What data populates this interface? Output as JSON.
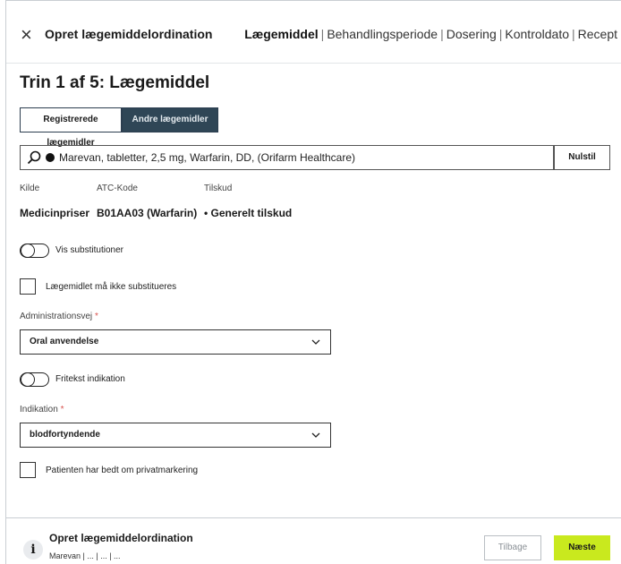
{
  "header": {
    "title": "Opret lægemiddelordination",
    "steps": [
      "Lægemiddel",
      "Behandlingsperiode",
      "Dosering",
      "Kontroldato",
      "Recept"
    ],
    "step_sep": "|"
  },
  "step_title": "Trin 1 af 5: Lægemiddel",
  "tabs": {
    "registered": "Registrerede lægemidler",
    "other": "Andre lægemidler"
  },
  "search": {
    "value": "Marevan, tabletter, 2,5 mg, Warfarin, DD, (Orifarm Healthcare)",
    "reset_label": "Nulstil"
  },
  "info": {
    "source_label": "Kilde",
    "source_value": "Medicinpriser",
    "atc_label": "ATC-Kode",
    "atc_value": "B01AA03 (Warfarin)",
    "subsidy_label": "Tilskud",
    "subsidy_value": "• Generelt tilskud"
  },
  "substitution_toggle": "Vis substitutioner",
  "no_substitute_checkbox": "Lægemidlet må ikke substitueres",
  "admin_route": {
    "label": "Administrationsvej",
    "required": "*",
    "value": "Oral anvendelse"
  },
  "free_text_toggle": "Fritekst indikation",
  "indication": {
    "label": "Indikation",
    "required": "*",
    "value": "blodfortyndende"
  },
  "private_checkbox": "Patienten har bedt om privatmarkering",
  "footer": {
    "title": "Opret lægemiddelordination",
    "subtitle": "Marevan | ... | ... | ...",
    "back_label": "Tilbage",
    "next_label": "Næste"
  },
  "colors": {
    "accent": "#c9e91e",
    "tab_dark": "#2f4656",
    "required": "#d9534f"
  }
}
